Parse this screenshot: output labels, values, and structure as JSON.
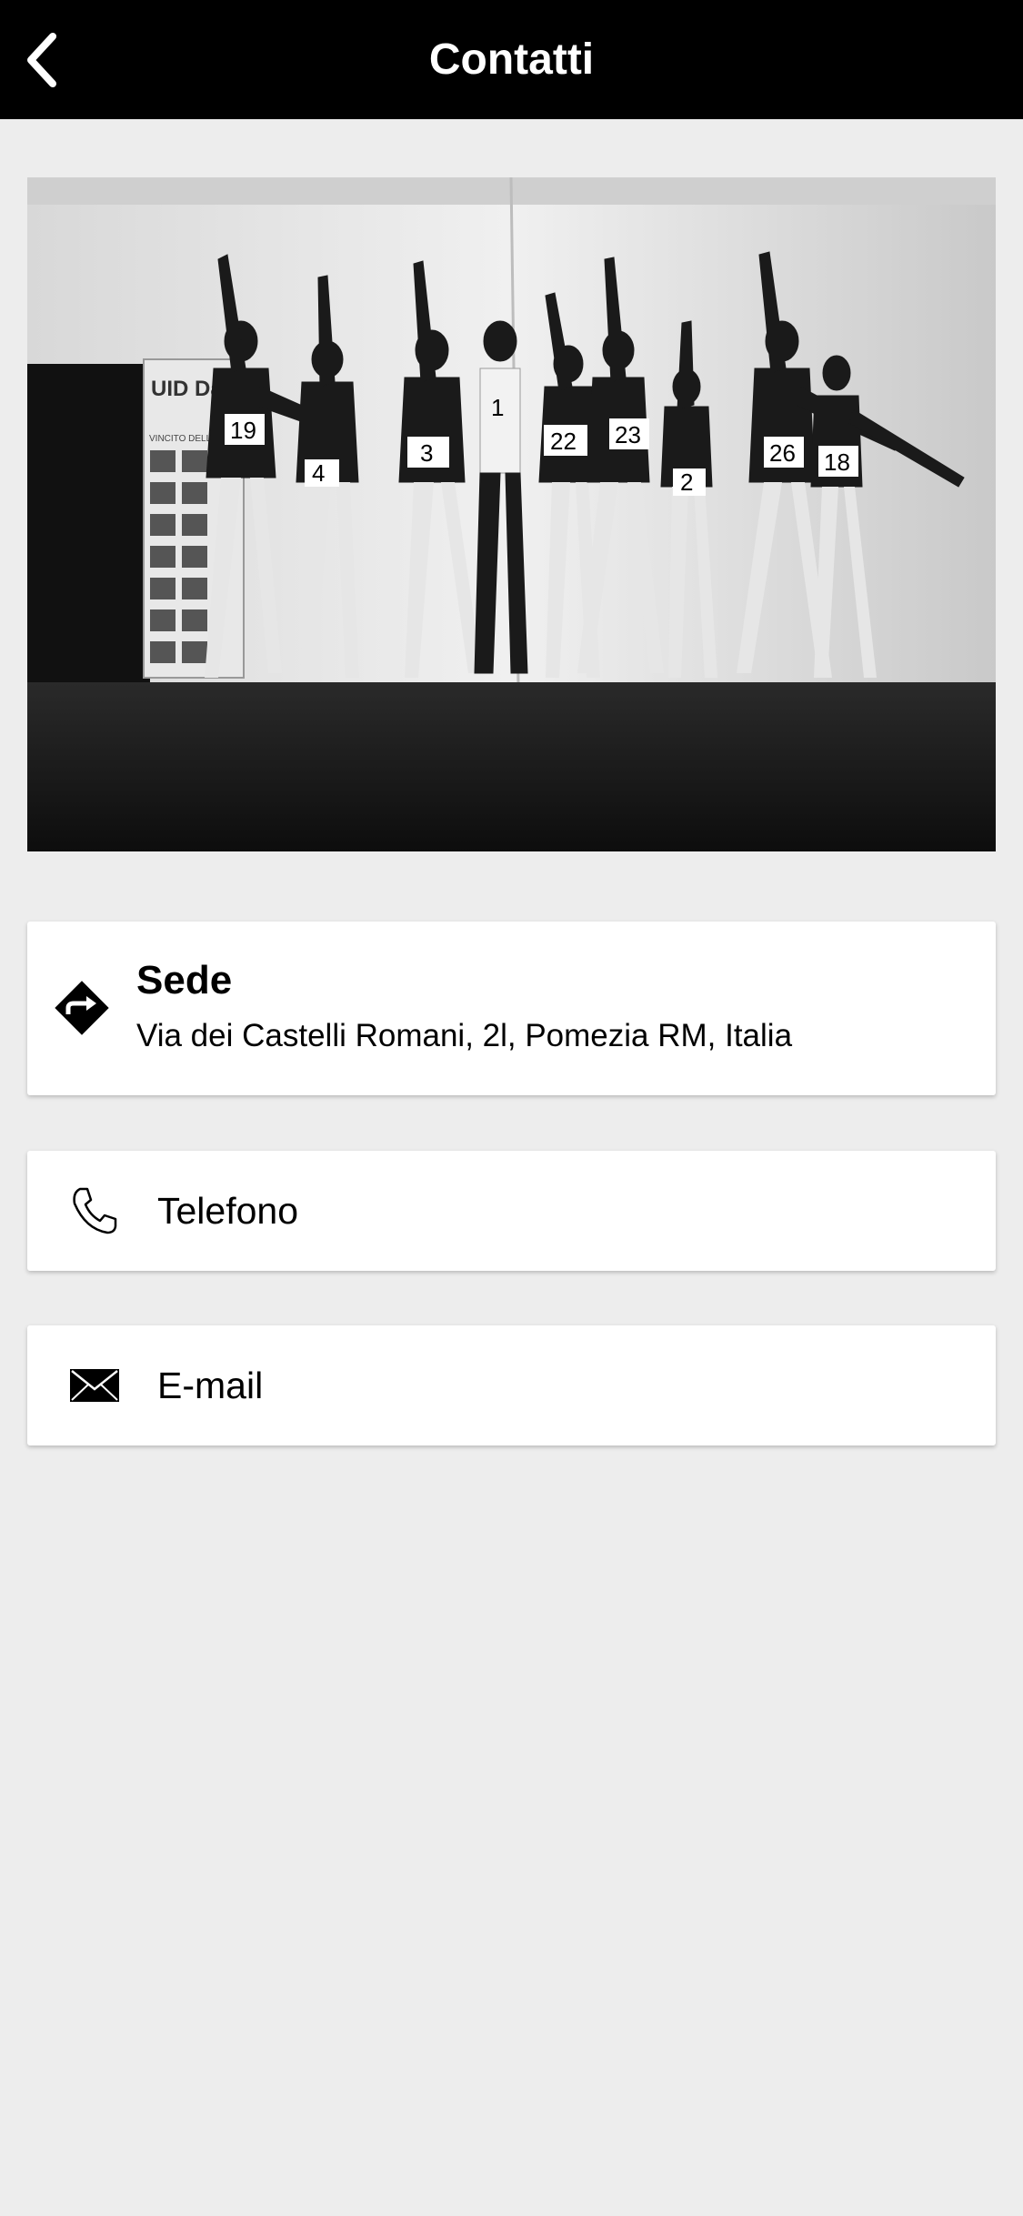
{
  "header": {
    "title": "Contatti",
    "back_icon": "chevron-left-icon"
  },
  "photo": {
    "banner_text": "UID Danza",
    "banner_subtext": "VINCITO DELLE SCORSE",
    "bib_numbers": [
      "19",
      "4",
      "3",
      "1",
      "22",
      "23",
      "2",
      "26",
      "18"
    ]
  },
  "contacts": {
    "sede": {
      "icon": "directions-icon",
      "title": "Sede",
      "address": "Via dei Castelli Romani, 2l, Pomezia RM, Italia"
    },
    "telefono": {
      "icon": "phone-icon",
      "label": "Telefono"
    },
    "email": {
      "icon": "envelope-icon",
      "label": "E-mail"
    }
  },
  "colors": {
    "header_bg": "#000000",
    "page_bg": "#ededed",
    "card_bg": "#ffffff"
  }
}
